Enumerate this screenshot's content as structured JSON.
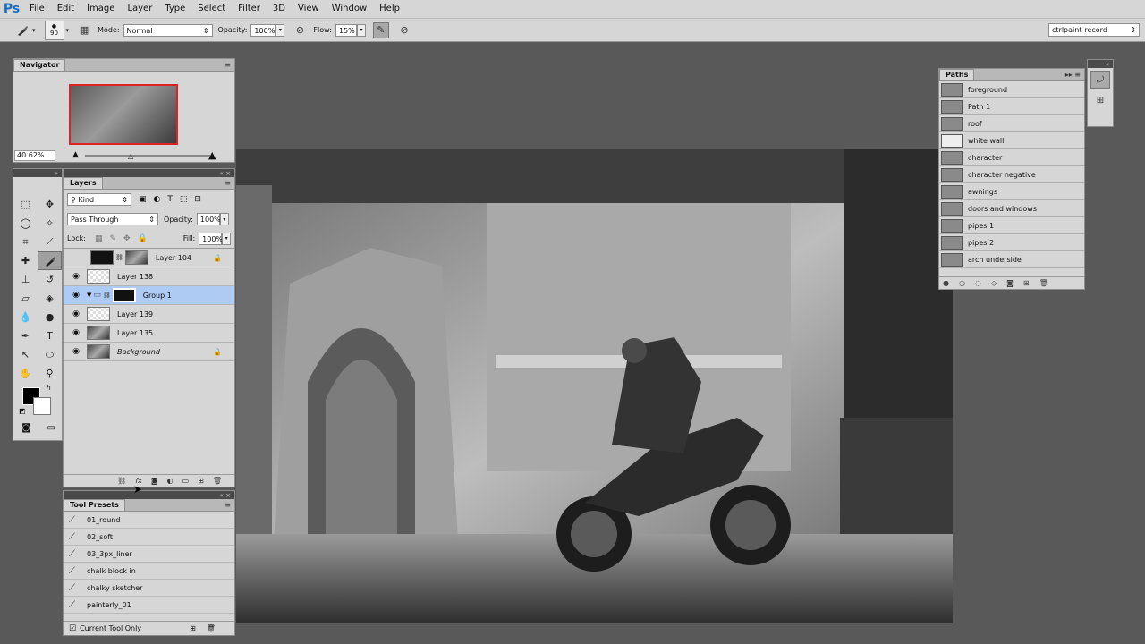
{
  "app": {
    "logo": "Ps"
  },
  "menu": [
    "File",
    "Edit",
    "Image",
    "Layer",
    "Type",
    "Select",
    "Filter",
    "3D",
    "View",
    "Window",
    "Help"
  ],
  "options": {
    "brush_size": "90",
    "mode_label": "Mode:",
    "mode_value": "Normal",
    "opacity_label": "Opacity:",
    "opacity_value": "100%",
    "flow_label": "Flow:",
    "flow_value": "15%",
    "workspace": "ctrlpaint-record"
  },
  "navigator": {
    "tab": "Navigator",
    "zoom": "40.62%"
  },
  "layers": {
    "tab": "Layers",
    "kind": "Kind",
    "blend_mode": "Pass Through",
    "opacity_label": "Opacity:",
    "opacity_value": "100%",
    "lock_label": "Lock:",
    "fill_label": "Fill:",
    "fill_value": "100%",
    "items": [
      {
        "name": "Layer 104"
      },
      {
        "name": "Layer 138"
      },
      {
        "name": "Group 1"
      },
      {
        "name": "Layer 139"
      },
      {
        "name": "Layer 135"
      },
      {
        "name": "Background"
      }
    ]
  },
  "tool_presets": {
    "tab": "Tool Presets",
    "items": [
      "01_round",
      "02_soft",
      "03_3px_liner",
      "chalk block in",
      "chalky sketcher",
      "painterly_01"
    ],
    "current_only": "Current Tool Only"
  },
  "paths": {
    "tab": "Paths",
    "items": [
      "foreground",
      "Path 1",
      "roof",
      "white wall",
      "character",
      "character negative",
      "awnings",
      "doors and windows",
      "pipes 1",
      "pipes 2",
      "arch underside"
    ]
  },
  "icons": {
    "brush": "brush-icon",
    "eye": "eye-icon",
    "lock": "lock-icon"
  },
  "colors": {
    "accent": "#1b6fc3",
    "selection": "#aecbf3",
    "foreground": "#000000",
    "background": "#ffffff"
  }
}
